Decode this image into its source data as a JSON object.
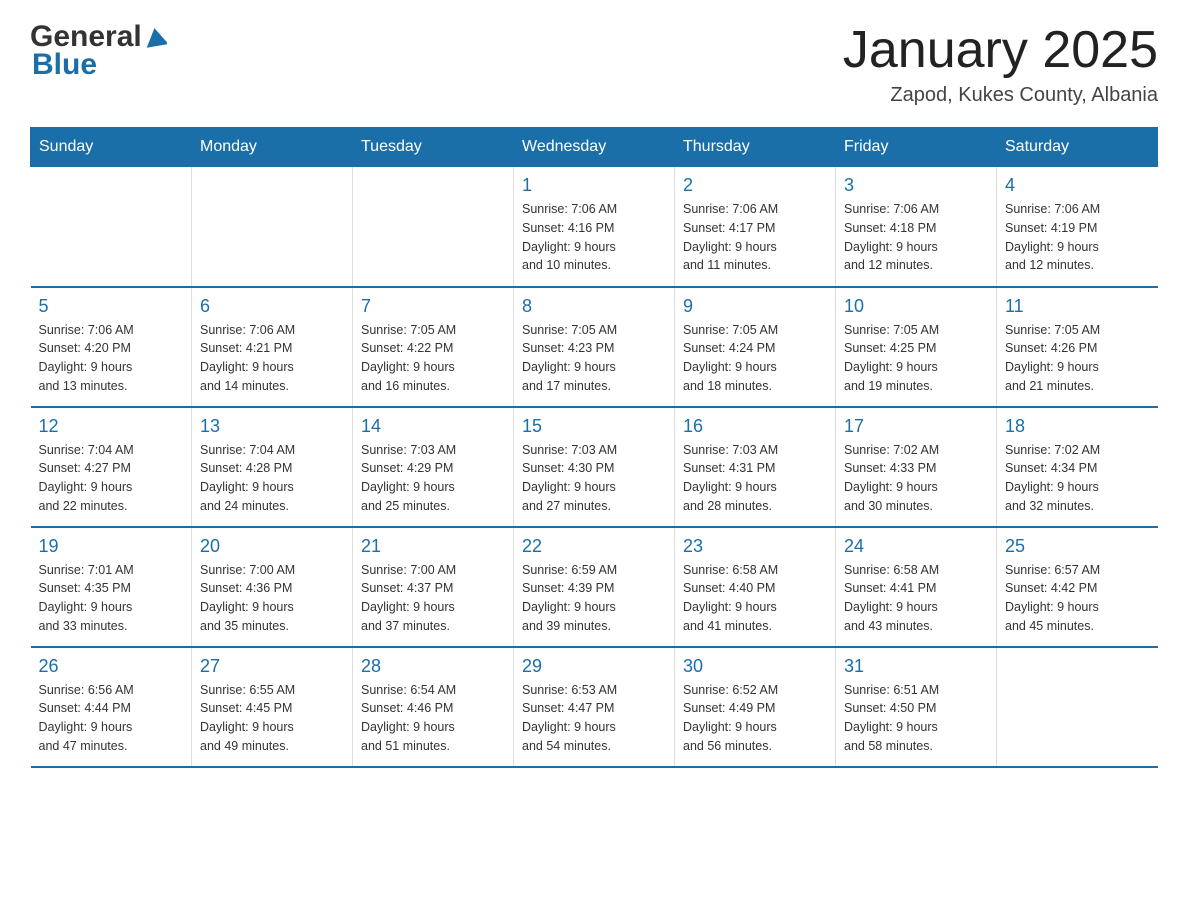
{
  "header": {
    "logo": {
      "general": "General",
      "blue": "Blue"
    },
    "title": "January 2025",
    "subtitle": "Zapod, Kukes County, Albania"
  },
  "weekdays": [
    "Sunday",
    "Monday",
    "Tuesday",
    "Wednesday",
    "Thursday",
    "Friday",
    "Saturday"
  ],
  "weeks": [
    [
      {
        "day": "",
        "info": ""
      },
      {
        "day": "",
        "info": ""
      },
      {
        "day": "",
        "info": ""
      },
      {
        "day": "1",
        "info": "Sunrise: 7:06 AM\nSunset: 4:16 PM\nDaylight: 9 hours\nand 10 minutes."
      },
      {
        "day": "2",
        "info": "Sunrise: 7:06 AM\nSunset: 4:17 PM\nDaylight: 9 hours\nand 11 minutes."
      },
      {
        "day": "3",
        "info": "Sunrise: 7:06 AM\nSunset: 4:18 PM\nDaylight: 9 hours\nand 12 minutes."
      },
      {
        "day": "4",
        "info": "Sunrise: 7:06 AM\nSunset: 4:19 PM\nDaylight: 9 hours\nand 12 minutes."
      }
    ],
    [
      {
        "day": "5",
        "info": "Sunrise: 7:06 AM\nSunset: 4:20 PM\nDaylight: 9 hours\nand 13 minutes."
      },
      {
        "day": "6",
        "info": "Sunrise: 7:06 AM\nSunset: 4:21 PM\nDaylight: 9 hours\nand 14 minutes."
      },
      {
        "day": "7",
        "info": "Sunrise: 7:05 AM\nSunset: 4:22 PM\nDaylight: 9 hours\nand 16 minutes."
      },
      {
        "day": "8",
        "info": "Sunrise: 7:05 AM\nSunset: 4:23 PM\nDaylight: 9 hours\nand 17 minutes."
      },
      {
        "day": "9",
        "info": "Sunrise: 7:05 AM\nSunset: 4:24 PM\nDaylight: 9 hours\nand 18 minutes."
      },
      {
        "day": "10",
        "info": "Sunrise: 7:05 AM\nSunset: 4:25 PM\nDaylight: 9 hours\nand 19 minutes."
      },
      {
        "day": "11",
        "info": "Sunrise: 7:05 AM\nSunset: 4:26 PM\nDaylight: 9 hours\nand 21 minutes."
      }
    ],
    [
      {
        "day": "12",
        "info": "Sunrise: 7:04 AM\nSunset: 4:27 PM\nDaylight: 9 hours\nand 22 minutes."
      },
      {
        "day": "13",
        "info": "Sunrise: 7:04 AM\nSunset: 4:28 PM\nDaylight: 9 hours\nand 24 minutes."
      },
      {
        "day": "14",
        "info": "Sunrise: 7:03 AM\nSunset: 4:29 PM\nDaylight: 9 hours\nand 25 minutes."
      },
      {
        "day": "15",
        "info": "Sunrise: 7:03 AM\nSunset: 4:30 PM\nDaylight: 9 hours\nand 27 minutes."
      },
      {
        "day": "16",
        "info": "Sunrise: 7:03 AM\nSunset: 4:31 PM\nDaylight: 9 hours\nand 28 minutes."
      },
      {
        "day": "17",
        "info": "Sunrise: 7:02 AM\nSunset: 4:33 PM\nDaylight: 9 hours\nand 30 minutes."
      },
      {
        "day": "18",
        "info": "Sunrise: 7:02 AM\nSunset: 4:34 PM\nDaylight: 9 hours\nand 32 minutes."
      }
    ],
    [
      {
        "day": "19",
        "info": "Sunrise: 7:01 AM\nSunset: 4:35 PM\nDaylight: 9 hours\nand 33 minutes."
      },
      {
        "day": "20",
        "info": "Sunrise: 7:00 AM\nSunset: 4:36 PM\nDaylight: 9 hours\nand 35 minutes."
      },
      {
        "day": "21",
        "info": "Sunrise: 7:00 AM\nSunset: 4:37 PM\nDaylight: 9 hours\nand 37 minutes."
      },
      {
        "day": "22",
        "info": "Sunrise: 6:59 AM\nSunset: 4:39 PM\nDaylight: 9 hours\nand 39 minutes."
      },
      {
        "day": "23",
        "info": "Sunrise: 6:58 AM\nSunset: 4:40 PM\nDaylight: 9 hours\nand 41 minutes."
      },
      {
        "day": "24",
        "info": "Sunrise: 6:58 AM\nSunset: 4:41 PM\nDaylight: 9 hours\nand 43 minutes."
      },
      {
        "day": "25",
        "info": "Sunrise: 6:57 AM\nSunset: 4:42 PM\nDaylight: 9 hours\nand 45 minutes."
      }
    ],
    [
      {
        "day": "26",
        "info": "Sunrise: 6:56 AM\nSunset: 4:44 PM\nDaylight: 9 hours\nand 47 minutes."
      },
      {
        "day": "27",
        "info": "Sunrise: 6:55 AM\nSunset: 4:45 PM\nDaylight: 9 hours\nand 49 minutes."
      },
      {
        "day": "28",
        "info": "Sunrise: 6:54 AM\nSunset: 4:46 PM\nDaylight: 9 hours\nand 51 minutes."
      },
      {
        "day": "29",
        "info": "Sunrise: 6:53 AM\nSunset: 4:47 PM\nDaylight: 9 hours\nand 54 minutes."
      },
      {
        "day": "30",
        "info": "Sunrise: 6:52 AM\nSunset: 4:49 PM\nDaylight: 9 hours\nand 56 minutes."
      },
      {
        "day": "31",
        "info": "Sunrise: 6:51 AM\nSunset: 4:50 PM\nDaylight: 9 hours\nand 58 minutes."
      },
      {
        "day": "",
        "info": ""
      }
    ]
  ]
}
